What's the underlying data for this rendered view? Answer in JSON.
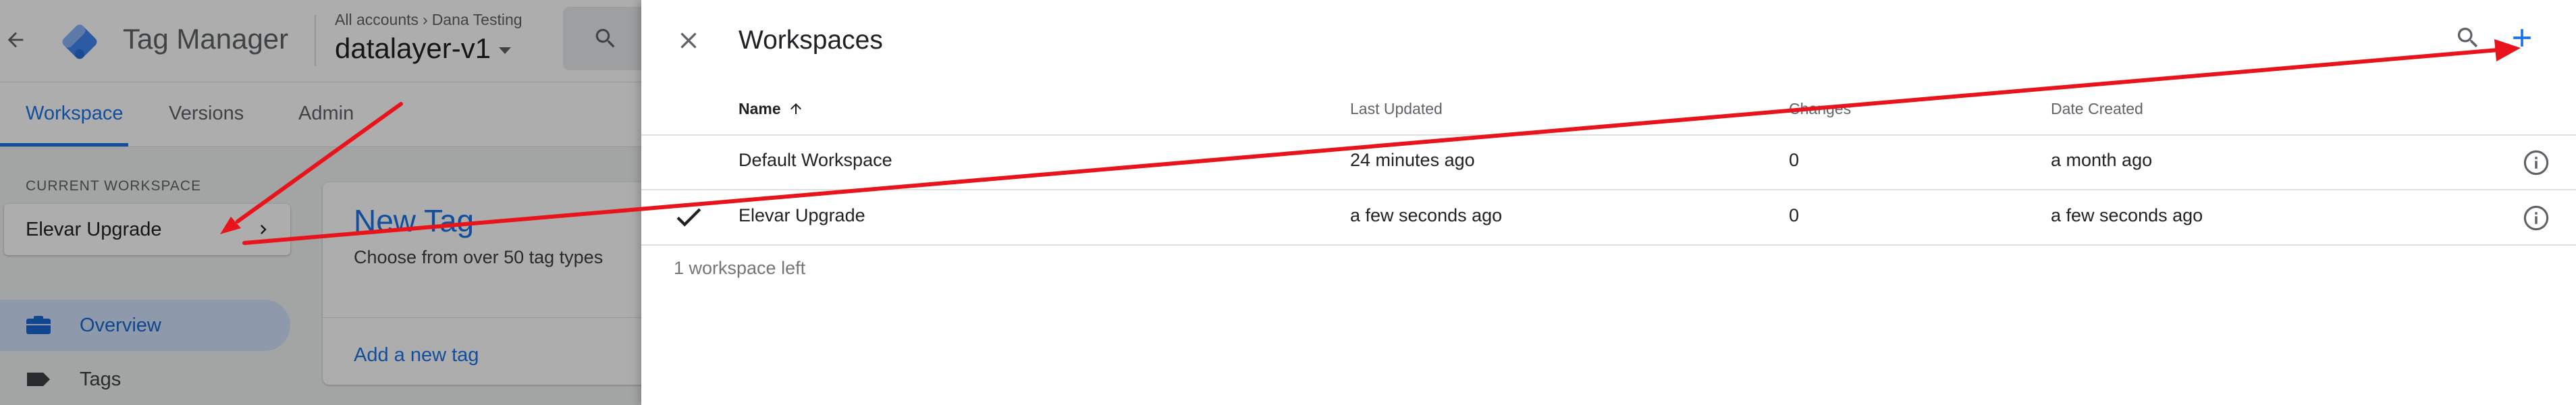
{
  "app": {
    "product_name": "Tag Manager",
    "breadcrumb": {
      "accounts": "All accounts",
      "separator": "›",
      "account": "Dana Testing"
    },
    "container_name": "datalayer-v1",
    "tabs": [
      {
        "label": "Workspace",
        "active": true
      },
      {
        "label": "Versions",
        "active": false
      },
      {
        "label": "Admin",
        "active": false
      }
    ],
    "current_workspace_label": "CURRENT WORKSPACE",
    "current_workspace_name": "Elevar Upgrade",
    "nav": [
      {
        "label": "Overview",
        "icon": "briefcase-icon",
        "active": true
      },
      {
        "label": "Tags",
        "icon": "tag-icon",
        "active": false
      }
    ],
    "new_tag_card": {
      "title": "New Tag",
      "subtitle": "Choose from over 50 tag types",
      "link": "Add a new tag"
    }
  },
  "panel": {
    "title": "Workspaces",
    "columns": [
      "Name",
      "Last Updated",
      "Changes",
      "Date Created"
    ],
    "sort": {
      "column": "Name",
      "direction": "ascending"
    },
    "rows": [
      {
        "selected": false,
        "name": "Default Workspace",
        "last_updated": "24 minutes ago",
        "changes": "0",
        "date_created": "a month ago"
      },
      {
        "selected": true,
        "name": "Elevar Upgrade",
        "last_updated": "a few seconds ago",
        "changes": "0",
        "date_created": "a few seconds ago"
      }
    ],
    "footer": "1 workspace left"
  },
  "colors": {
    "accent": "#1a73e8",
    "annotation": "#e8131b",
    "scrim": "rgba(0,0,0,0.32)"
  },
  "icons": [
    "back-arrow-icon",
    "tag-manager-logo",
    "search-icon",
    "chevron-right-icon",
    "close-icon",
    "add-icon",
    "sort-up-arrow-icon",
    "check-icon",
    "info-icon"
  ]
}
